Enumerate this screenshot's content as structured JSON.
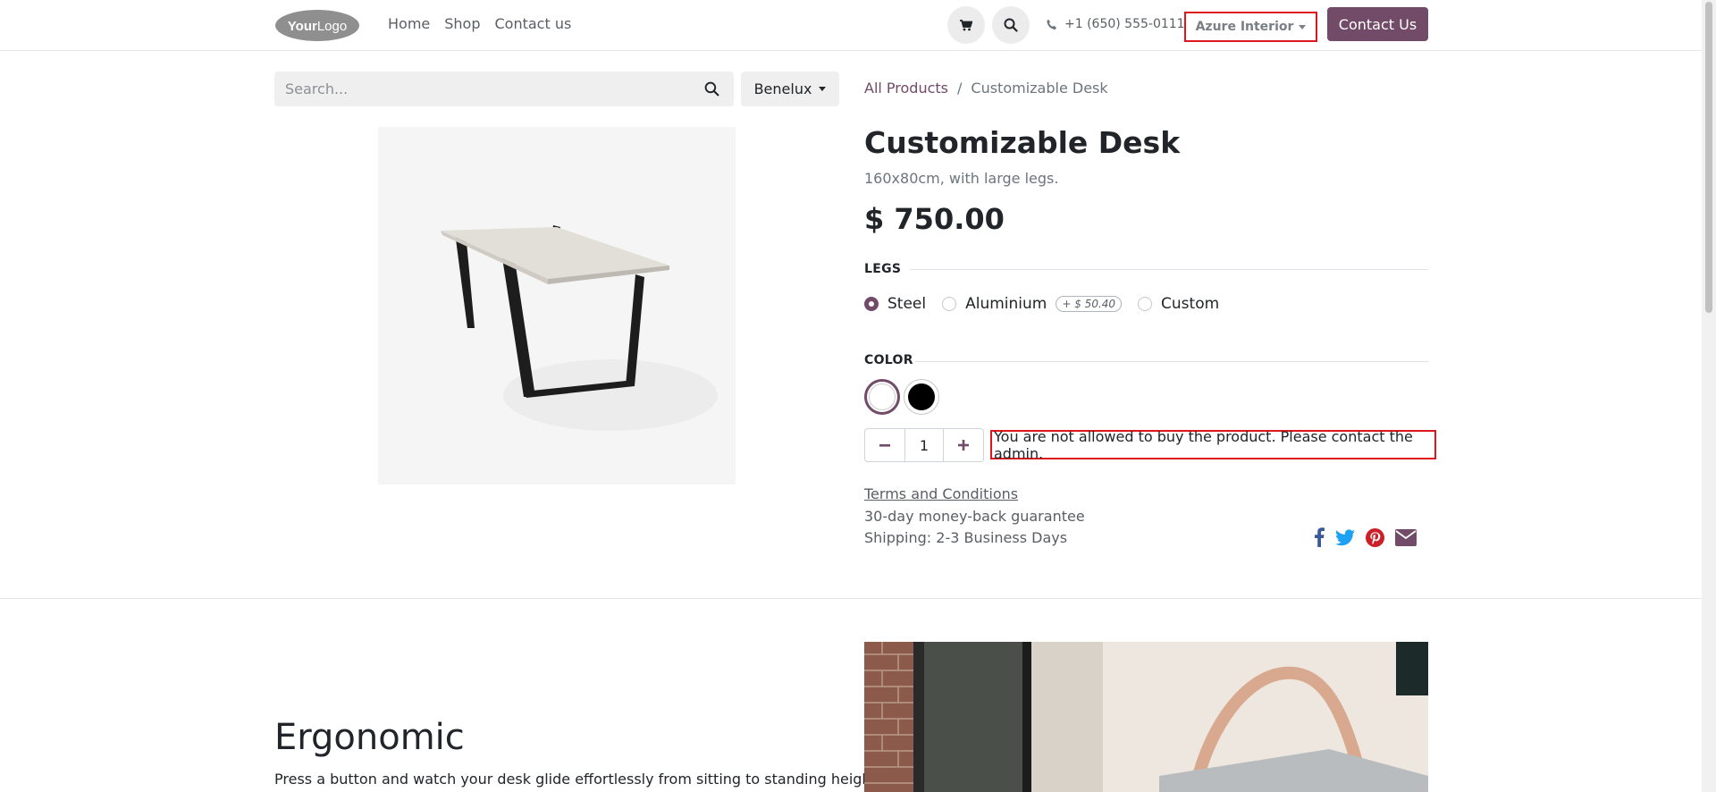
{
  "header": {
    "logo_text": "YourLogo",
    "nav": [
      "Home",
      "Shop",
      "Contact us"
    ],
    "phone": "+1 (650) 555-0111",
    "company": "Azure Interior",
    "contact_button": "Contact Us"
  },
  "search": {
    "placeholder": "Search...",
    "pricelist": "Benelux"
  },
  "breadcrumb": {
    "root": "All Products",
    "separator": "/",
    "current": "Customizable Desk"
  },
  "product": {
    "title": "Customizable Desk",
    "description": "160x80cm, with large legs.",
    "price": "$ 750.00",
    "legs": {
      "label": "LEGS",
      "options": [
        {
          "label": "Steel",
          "checked": true
        },
        {
          "label": "Aluminium",
          "extra": "+ $ 50.40"
        },
        {
          "label": "Custom"
        }
      ]
    },
    "color": {
      "label": "COLOR",
      "swatches": [
        {
          "name": "White",
          "hex": "#ffffff",
          "selected": true
        },
        {
          "name": "Black",
          "hex": "#000000",
          "selected": false
        }
      ]
    },
    "quantity": "1",
    "warning": "You are not allowed to buy the product. Please contact the admin.",
    "terms": "Terms and Conditions",
    "guarantee": "30-day money-back guarantee",
    "shipping": "Shipping: 2-3 Business Days",
    "share_icons": [
      "facebook-icon",
      "twitter-icon",
      "pinterest-icon",
      "envelope-icon"
    ]
  },
  "section": {
    "title": "Ergonomic",
    "text": "Press a button and watch your desk glide effortlessly from sitting to standing height in"
  },
  "colors": {
    "brand": "#714b67",
    "highlight": "#e0161d",
    "facebook": "#3b5998",
    "twitter": "#1da1f2",
    "pinterest": "#cb2027"
  }
}
